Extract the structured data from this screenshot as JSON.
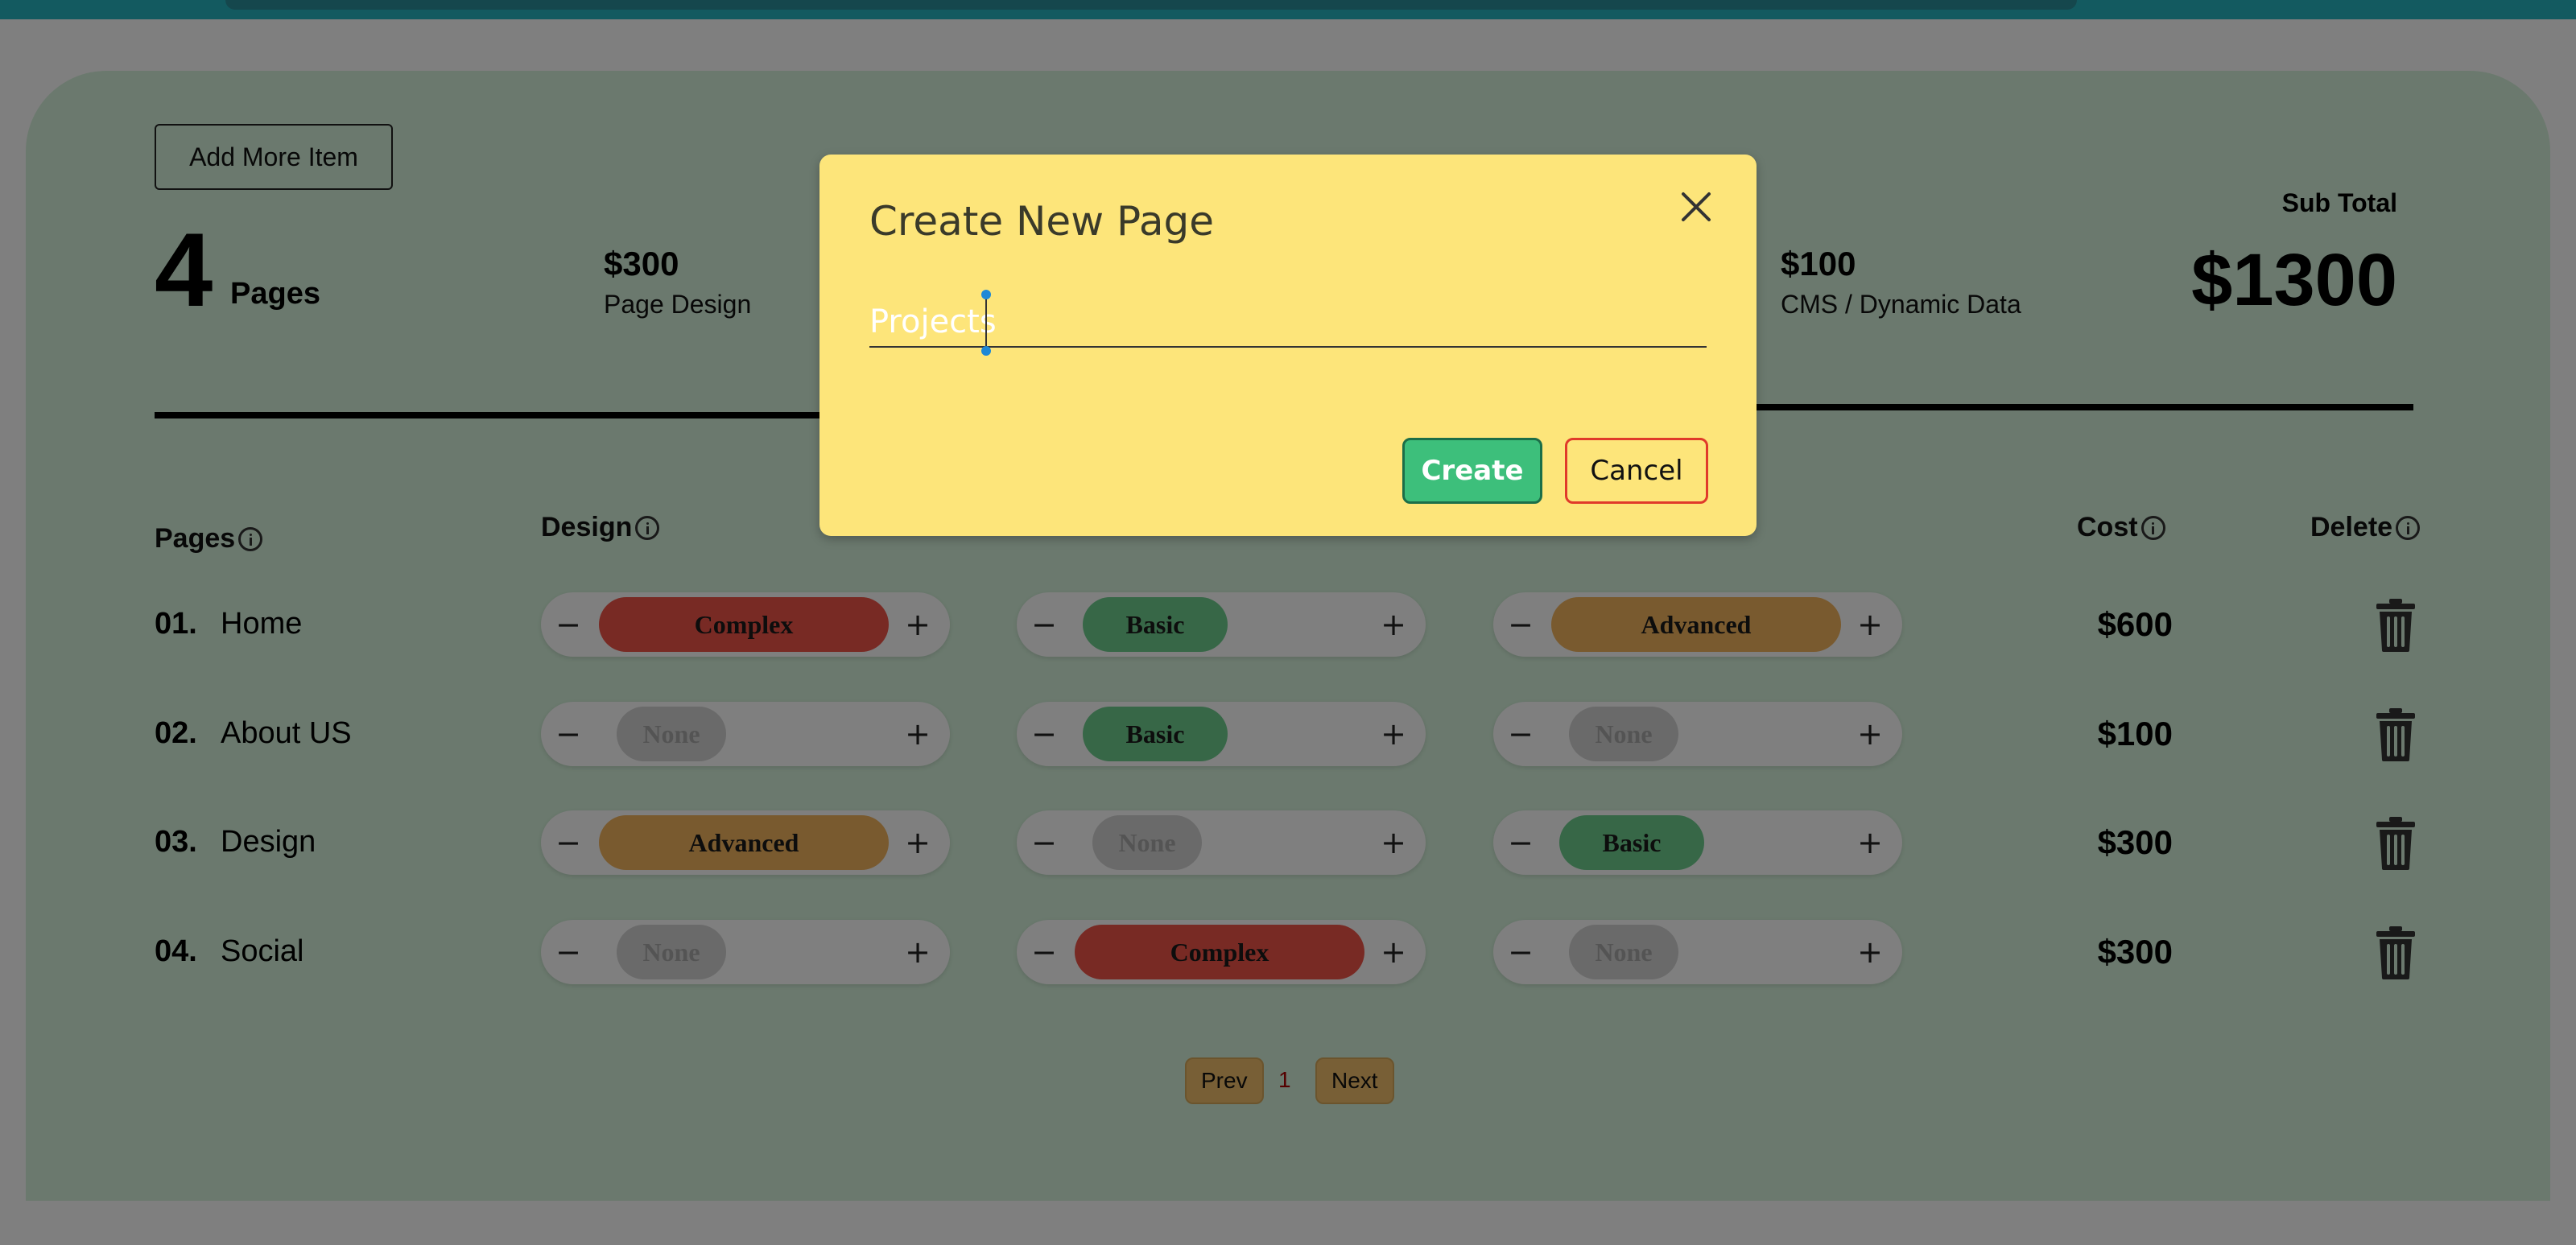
{
  "summary": {
    "add_more_label": "Add More Item",
    "page_count": "4",
    "page_word": "Pages",
    "stats": [
      {
        "value": "$300",
        "label": "Page Design"
      },
      {
        "value": "$100",
        "label": "CMS / Dynamic Data"
      }
    ],
    "subtotal_label": "Sub Total",
    "subtotal_value": "$1300"
  },
  "table": {
    "headers": {
      "pages": "Pages",
      "design": "Design",
      "cost": "Cost",
      "delete": "Delete"
    },
    "rows": [
      {
        "num": "01.",
        "name": "Home",
        "levels": [
          "Complex",
          "Basic",
          "Advanced"
        ],
        "cost": "$600"
      },
      {
        "num": "02.",
        "name": "About US",
        "levels": [
          "None",
          "Basic",
          "None"
        ],
        "cost": "$100"
      },
      {
        "num": "03.",
        "name": "Design",
        "levels": [
          "Advanced",
          "None",
          "Basic"
        ],
        "cost": "$300"
      },
      {
        "num": "04.",
        "name": "Social",
        "levels": [
          "None",
          "Complex",
          "None"
        ],
        "cost": "$300"
      }
    ],
    "stepper_minus": "−",
    "stepper_plus": "+"
  },
  "level_colors": {
    "Complex": "#f05548",
    "Basic": "#6fcf8f",
    "Advanced": "#f3b45e",
    "None": "#d4d4d4"
  },
  "pager": {
    "prev_label": "Prev",
    "page": "1",
    "next_label": "Next"
  },
  "modal": {
    "title": "Create New Page",
    "input_value": "Projects",
    "create_label": "Create",
    "cancel_label": "Cancel"
  }
}
